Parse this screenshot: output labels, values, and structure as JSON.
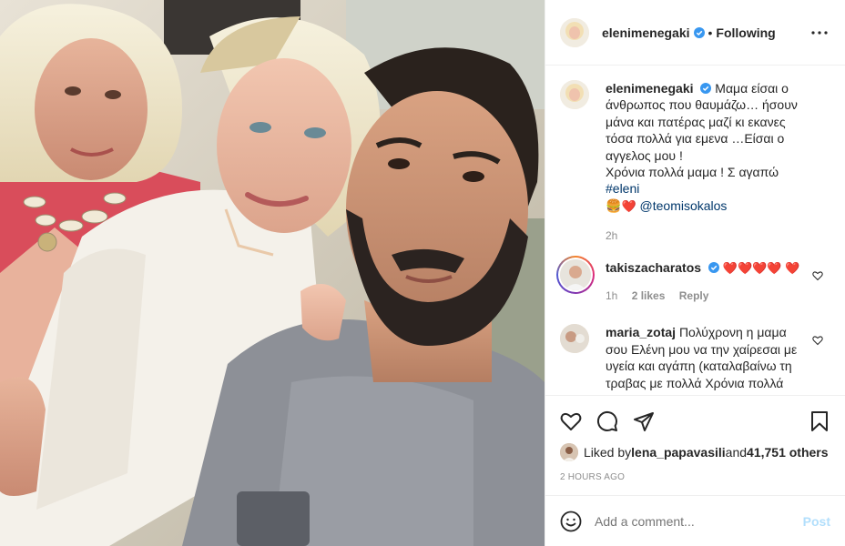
{
  "header": {
    "username": "elenimenegaki",
    "separator": "•",
    "follow_state": "Following"
  },
  "caption": {
    "username": "elenimenegaki",
    "text": "Μαμα είσαι ο άνθρωπος που θαυμάζω… ήσουν μάνα και πατέρας μαζί κι εκανες τόσα πολλά για εμενα …Είσαι ο αγγελος μου !",
    "line2": "Χρόνια πολλά μαμα ! Σ αγαπώ ",
    "hashtag": "#eleni",
    "mention": "@teomisokalos",
    "age": "2h"
  },
  "comments": [
    {
      "username": "takiszacharatos",
      "verified": true,
      "hearts": "❤️❤️❤️❤️ ❤️",
      "age": "1h",
      "likes": "2 likes",
      "reply": "Reply"
    },
    {
      "username": "maria_zotaj",
      "text": "Πολύχρονη η μαμα σου Ελένη μου να την χαίρεσαι με υγεία και αγάπη (καταλαβαίνω τη τραβας με πολλά Χρόνια πολλά",
      "verified": false
    }
  ],
  "likes": {
    "prefix": "Liked by ",
    "user": "lena_papavasili",
    "middle": " and ",
    "count": "41,751 others"
  },
  "timestamp": "2 HOURS AGO",
  "comment_box": {
    "placeholder": "Add a comment...",
    "post_label": "Post"
  },
  "colors": {
    "link": "#00376b",
    "verified": "#3897f0",
    "post_disabled": "#b2dffc",
    "heart": "#ed1c24"
  },
  "icons": [
    "more-horizontal-icon",
    "verified-badge-icon",
    "heart-icon",
    "comment-icon",
    "share-icon",
    "bookmark-icon",
    "emoji-icon"
  ]
}
